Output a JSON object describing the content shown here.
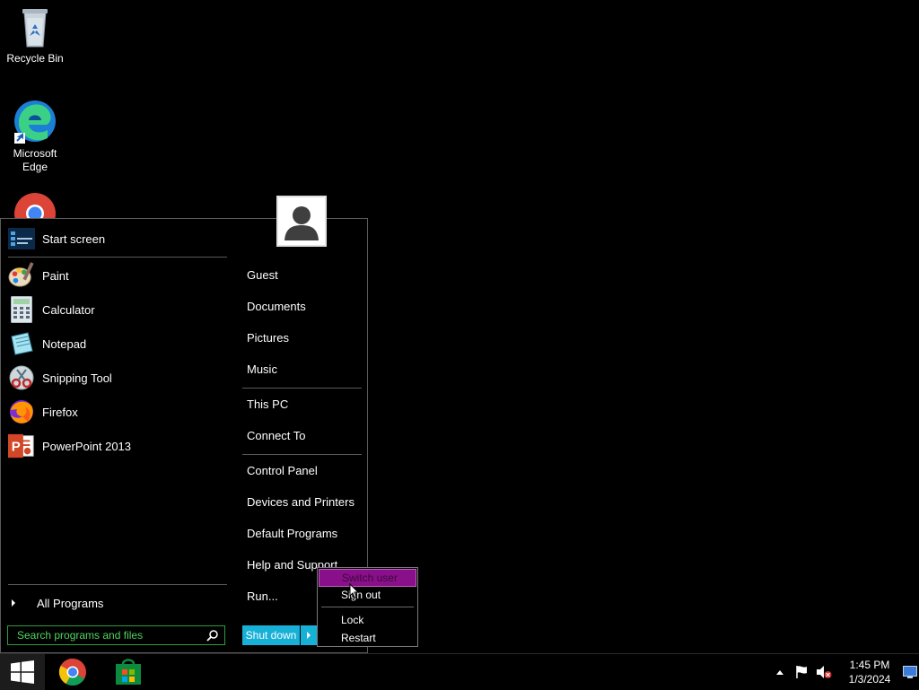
{
  "desktop": {
    "icons": [
      {
        "label": "Recycle Bin",
        "icon": "recycle-bin-icon"
      },
      {
        "label": "Microsoft Edge",
        "icon": "edge-icon"
      },
      {
        "label": "",
        "icon": "chrome-icon"
      }
    ]
  },
  "start_menu": {
    "pinned": [
      {
        "label": "Start screen",
        "icon": "start-screen-icon"
      }
    ],
    "recent": [
      {
        "label": "Paint",
        "icon": "paint-icon"
      },
      {
        "label": "Calculator",
        "icon": "calculator-icon"
      },
      {
        "label": "Notepad",
        "icon": "notepad-icon"
      },
      {
        "label": "Snipping Tool",
        "icon": "snipping-tool-icon"
      },
      {
        "label": "Firefox",
        "icon": "firefox-icon"
      },
      {
        "label": "PowerPoint 2013",
        "icon": "powerpoint-icon"
      }
    ],
    "all_programs": "All Programs",
    "search_placeholder": "Search programs and files",
    "right_items": [
      "Guest",
      "Documents",
      "Pictures",
      "Music",
      "This PC",
      "Connect To",
      "Control Panel",
      "Devices and Printers",
      "Default Programs",
      "Help and Support",
      "Run..."
    ],
    "shutdown_label": "Shut down",
    "power_menu": {
      "items": [
        "Switch user",
        "Sign out",
        "Lock",
        "Restart"
      ],
      "highlighted": "Switch user"
    }
  },
  "taskbar": {
    "time": "1:45 PM",
    "date": "1/3/2024",
    "pinned": [
      {
        "icon": "chrome-icon"
      },
      {
        "icon": "store-icon"
      }
    ]
  },
  "colors": {
    "accent_cyan": "#17b0d6",
    "search_green": "#4fd45f",
    "highlight_purple": "#8a0f8a"
  }
}
